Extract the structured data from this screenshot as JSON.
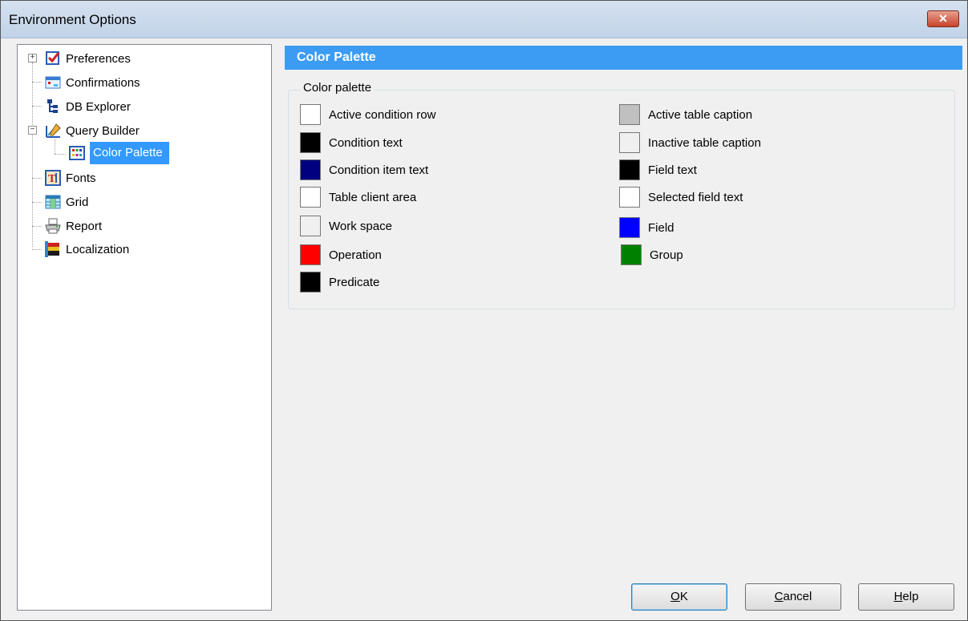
{
  "window": {
    "title": "Environment Options",
    "close_glyph": "✕"
  },
  "tree": {
    "items": [
      {
        "label": "Preferences",
        "icon": "preferences-icon",
        "expander": "+"
      },
      {
        "label": "Confirmations",
        "icon": "confirmations-icon"
      },
      {
        "label": "DB Explorer",
        "icon": "db-explorer-icon"
      },
      {
        "label": "Query Builder",
        "icon": "query-builder-icon",
        "expander": "−"
      },
      {
        "label": "Color Palette",
        "icon": "color-palette-icon",
        "selected": true
      },
      {
        "label": "Fonts",
        "icon": "fonts-icon"
      },
      {
        "label": "Grid",
        "icon": "grid-icon"
      },
      {
        "label": "Report",
        "icon": "report-icon"
      },
      {
        "label": "Localization",
        "icon": "localization-icon"
      }
    ]
  },
  "content": {
    "header": "Color Palette",
    "group_title": "Color palette",
    "left_colors": [
      {
        "label": "Active condition row",
        "color": "#ffffff"
      },
      {
        "label": "Condition text",
        "color": "#000000"
      },
      {
        "label": "Condition item text",
        "color": "#000080"
      },
      {
        "label": "Table client area",
        "color": "#ffffff"
      },
      {
        "label": "Work space",
        "color": "#f0f0f0"
      },
      {
        "label": "Operation",
        "color": "#ff0000"
      },
      {
        "label": "Predicate",
        "color": "#000000"
      }
    ],
    "right_colors": [
      {
        "label": "Active table caption",
        "color": "#c0c0c0"
      },
      {
        "label": "Inactive table caption",
        "color": "#f0f0f0"
      },
      {
        "label": "Field text",
        "color": "#000000"
      },
      {
        "label": "Selected field text",
        "color": "#ffffff"
      },
      {
        "label": "Field",
        "color": "#0000ff"
      },
      {
        "label": "Group",
        "color": "#008000"
      }
    ]
  },
  "buttons": {
    "ok_mnemonic": "O",
    "ok_rest": "K",
    "cancel_mnemonic": "C",
    "cancel_rest": "ancel",
    "help_mnemonic": "H",
    "help_rest": "elp"
  }
}
